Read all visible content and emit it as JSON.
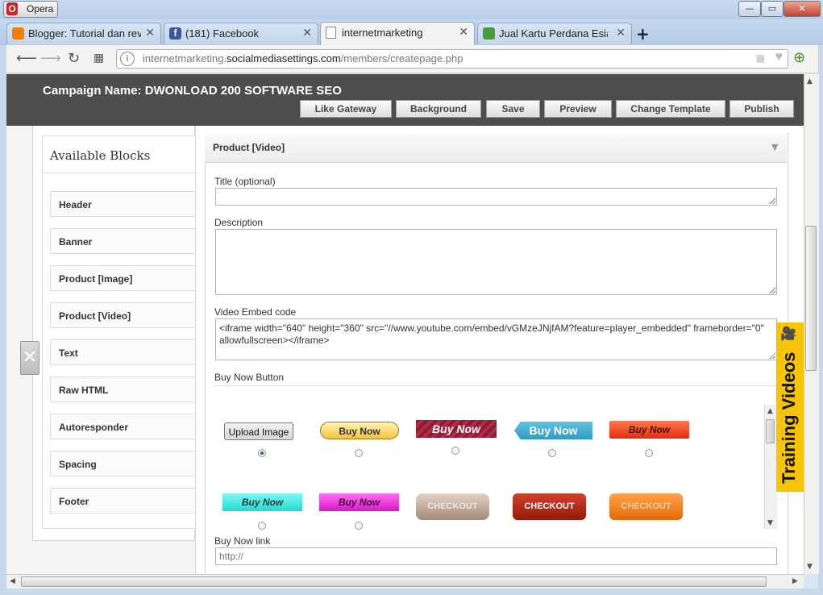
{
  "browser": {
    "menu_label": "Opera",
    "tabs": [
      {
        "label": "Blogger: Tutorial dan revie",
        "icon": "blogger-icon",
        "color": "#f57d00"
      },
      {
        "label": "(181) Facebook",
        "icon": "facebook-icon",
        "color": "#3b5998"
      },
      {
        "label": "internetmarketing",
        "icon": "page-icon",
        "color": "#666666"
      },
      {
        "label": "Jual Kartu Perdana Esia Cr",
        "icon": "shop-icon",
        "color": "#4a9b3a"
      }
    ],
    "url_host": "internetmarketing.",
    "url_domain": "socialmediasettings.com",
    "url_path": "/members/createpage.php"
  },
  "header": {
    "campaign": "Campaign Name: DWONLOAD 200 SOFTWARE SEO",
    "buttons": [
      "Like Gateway",
      "Background",
      "Save",
      "Preview",
      "Change Template",
      "Publish"
    ]
  },
  "sidebar": {
    "title": "Available Blocks",
    "items": [
      "Header",
      "Banner",
      "Product [Image]",
      "Product [Video]",
      "Text",
      "Raw HTML",
      "Autoresponder",
      "Spacing",
      "Footer"
    ]
  },
  "panel": {
    "title": "Product [Video]",
    "title_label": "Title (optional)",
    "title_value": "",
    "description_label": "Description",
    "description_value": "",
    "embed_label": "Video Embed code",
    "embed_value": "<iframe width=\"640\" height=\"360\" src=\"//www.youtube.com/embed/vGMzeJNjfAM?feature=player_embedded\" frameborder=\"0\" allowfullscreen></iframe>",
    "buy_now_label": "Buy Now Button",
    "upload_label": "Upload Image",
    "buy_now_text": "Buy Now",
    "checkout_text": "CHECKOUT",
    "selected_option": 0,
    "buy_now_link_label": "Buy Now link",
    "buy_now_link_placeholder": "http://"
  },
  "training": {
    "label": "Training Videos"
  }
}
